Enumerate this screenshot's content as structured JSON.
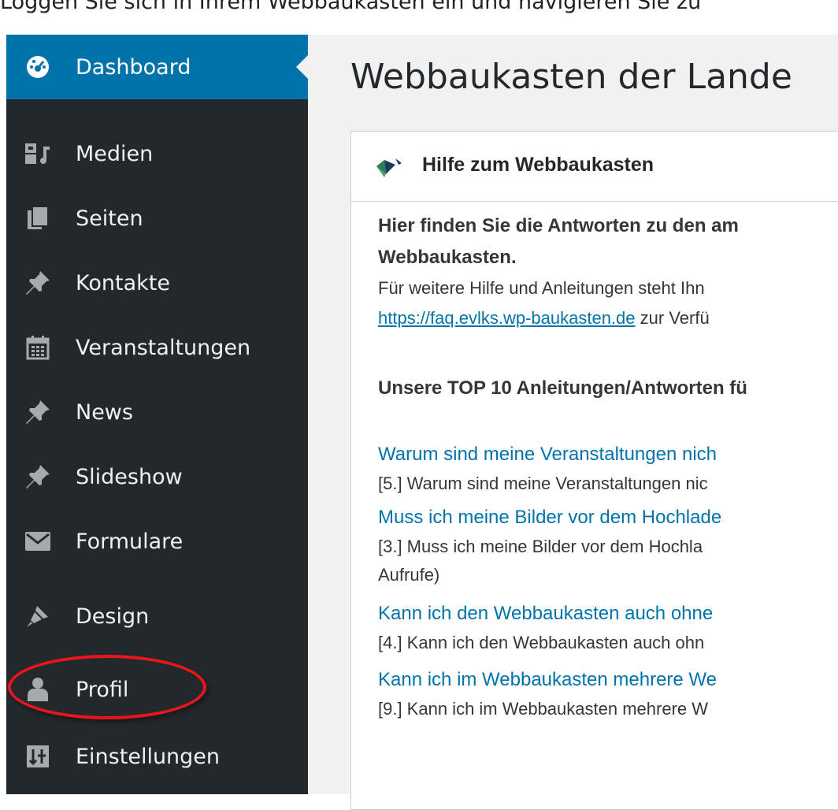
{
  "caption": "Loggen Sie sich in Ihrem Webbaukasten ein und navigieren Sie zu",
  "sidebar": {
    "items": [
      {
        "label": "Dashboard",
        "icon": "dashboard-icon",
        "active": true
      },
      {
        "label": "Medien",
        "icon": "media-icon"
      },
      {
        "label": "Seiten",
        "icon": "pages-icon"
      },
      {
        "label": "Kontakte",
        "icon": "pin-icon"
      },
      {
        "label": "Veranstaltungen",
        "icon": "calendar-icon"
      },
      {
        "label": "News",
        "icon": "pin-icon"
      },
      {
        "label": "Slideshow",
        "icon": "pin-icon"
      },
      {
        "label": "Formulare",
        "icon": "mail-icon"
      },
      {
        "label": "Design",
        "icon": "brush-icon"
      },
      {
        "label": "Profil",
        "icon": "user-icon"
      },
      {
        "label": "Einstellungen",
        "icon": "settings-icon"
      }
    ]
  },
  "main": {
    "page_title": "Webbaukasten der Lande",
    "box": {
      "title": "Hilfe zum Webbaukasten",
      "intro_line1": "Hier finden Sie die Antworten zu den am",
      "intro_line2": "Webbaukasten.",
      "further_line1": "Für weitere Hilfe und Anleitungen steht Ihn",
      "faq_link": "https://faq.evlks.wp-baukasten.de",
      "further_line2_suffix": " zur Verfü",
      "top10_heading": "Unsere TOP 10 Anleitungen/Antworten fü",
      "faqs": [
        {
          "title": "Warum sind meine Veranstaltungen nich",
          "excerpt": "[5.] Warum sind meine Veranstaltungen nic"
        },
        {
          "title": "Muss ich meine Bilder vor dem Hochlade",
          "excerpt": "[3.] Muss ich meine Bilder vor dem Hochla",
          "excerpt_line2": "Aufrufe)"
        },
        {
          "title": "Kann ich den Webbaukasten auch ohne",
          "excerpt": "[4.] Kann ich den Webbaukasten auch ohn"
        },
        {
          "title": "Kann ich im Webbaukasten mehrere We",
          "excerpt": "[9.] Kann ich im Webbaukasten mehrere W"
        }
      ]
    }
  },
  "colors": {
    "sidebar_bg": "#23282d",
    "active_bg": "#0073aa",
    "link": "#0073aa",
    "annotation_red": "#e8151b"
  }
}
